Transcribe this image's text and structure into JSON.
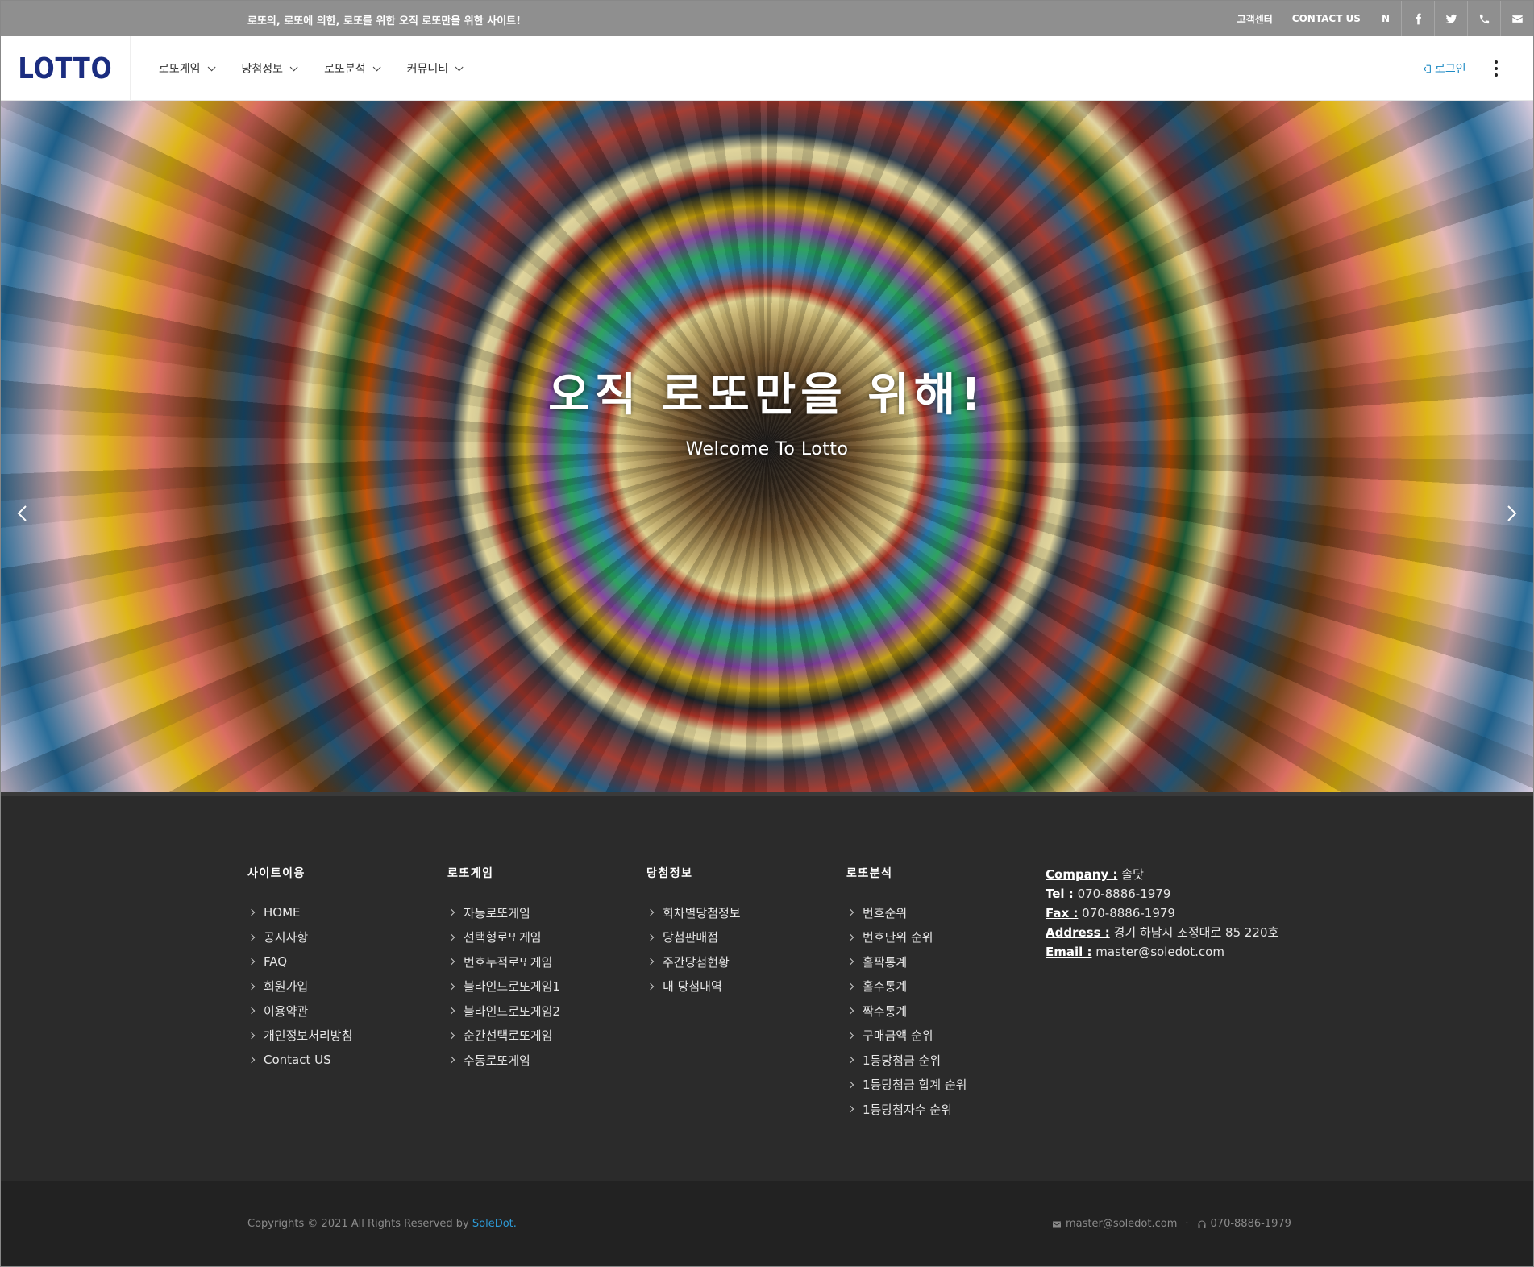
{
  "topbar": {
    "tagline": "로또의, 로또에 의한, 로또를 위한 오직 로또만을 위한 사이트!",
    "links": [
      "고객센터",
      "CONTACT US",
      "N"
    ],
    "icons": [
      "facebook-icon",
      "twitter-icon",
      "phone-icon",
      "envelope-icon"
    ]
  },
  "header": {
    "logo": "LOTTO",
    "nav": [
      {
        "label": "로또게임"
      },
      {
        "label": "당첨정보"
      },
      {
        "label": "로또분석"
      },
      {
        "label": "커뮤니티"
      }
    ],
    "login": "로그인"
  },
  "hero": {
    "title": "오직 로또만을 위해!",
    "subtitle": "Welcome To Lotto"
  },
  "footer": {
    "columns": [
      {
        "title": "사이트이용",
        "items": [
          "HOME",
          "공지사항",
          "FAQ",
          "회원가입",
          "이용약관",
          "개인정보처리방침",
          "Contact US"
        ]
      },
      {
        "title": "로또게임",
        "items": [
          "자동로또게임",
          "선택형로또게임",
          "번호누적로또게임",
          "블라인드로또게임1",
          "블라인드로또게임2",
          "순간선택로또게임",
          "수동로또게임"
        ]
      },
      {
        "title": "당첨정보",
        "items": [
          "회차별당첨정보",
          "당첨판매점",
          "주간당첨현황",
          "내 당첨내역"
        ]
      },
      {
        "title": "로또분석",
        "items": [
          "번호순위",
          "번호단위 순위",
          "홀짝통계",
          "홀수통계",
          "짝수통계",
          "구매금액 순위",
          "1등당첨금 순위",
          "1등당첨금 합계 순위",
          "1등당첨자수 순위"
        ]
      }
    ],
    "contact": {
      "company_label": "Company :",
      "company": "솔닷",
      "tel_label": "Tel :",
      "tel": "070-8886-1979",
      "fax_label": "Fax :",
      "fax": "070-8886-1979",
      "address_label": "Address :",
      "address": "경기 하남시 조정대로 85 220호",
      "email_label": "Email :",
      "email": "master@soledot.com"
    },
    "copyright_prefix": "Copyrights © 2021 All Rights Reserved by",
    "copyright_brand": "SoleDot.",
    "bottom_email": "master@soledot.com",
    "bottom_phone": "070-8886-1979"
  }
}
